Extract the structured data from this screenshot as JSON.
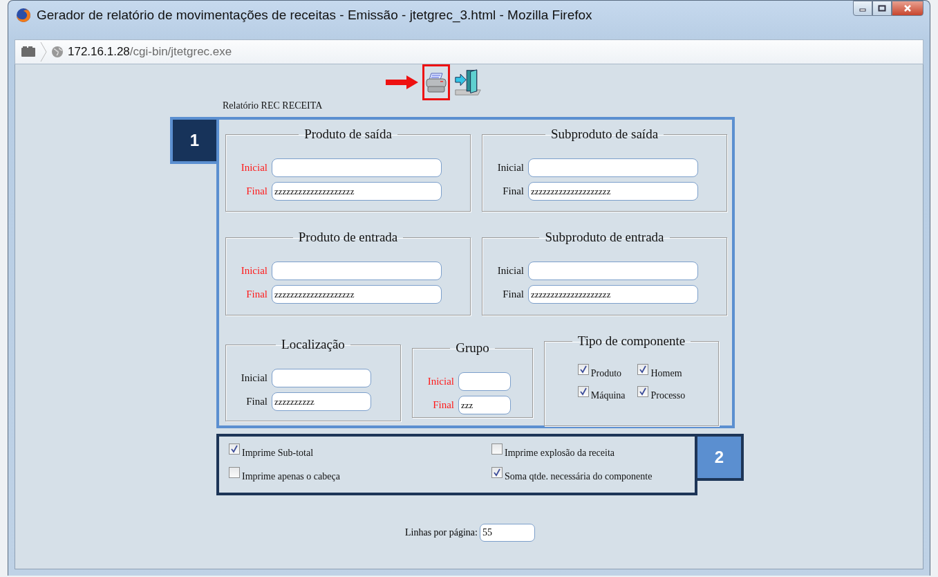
{
  "window": {
    "title": "Gerador de relatório de movimentações de receitas - Emissão - jtetgrec_3.html - Mozilla Firefox"
  },
  "address_bar": {
    "host": "172.16.1.28",
    "path": "/cgi-bin/jtetgrec.exe"
  },
  "toolbar": [
    {
      "kind": "print",
      "highlighted": true
    },
    {
      "kind": "exit",
      "highlighted": false
    }
  ],
  "report_title": "Relatório REC RECEITA",
  "section_1": {
    "badge": "1",
    "fieldsets": [
      {
        "kind": "range",
        "legend": "Produto de saída",
        "fields": [
          {
            "label": "Inicial",
            "required": true
          },
          {
            "label": "Final",
            "value": "zzzzzzzzzzzzzzzzzzzz",
            "required": true
          }
        ]
      },
      {
        "kind": "range",
        "legend": "Subproduto de saída",
        "fields": [
          {
            "label": "Inicial",
            "required": false
          },
          {
            "label": "Final",
            "value": "zzzzzzzzzzzzzzzzzzzz",
            "required": false
          }
        ]
      },
      {
        "kind": "range",
        "legend": "Produto de entrada",
        "fields": [
          {
            "label": "Inicial",
            "required": true
          },
          {
            "label": "Final",
            "value": "zzzzzzzzzzzzzzzzzzzz",
            "required": true
          }
        ]
      },
      {
        "kind": "range",
        "legend": "Subproduto de entrada",
        "fields": [
          {
            "label": "Inicial",
            "required": false
          },
          {
            "label": "Final",
            "value": "zzzzzzzzzzzzzzzzzzzz",
            "required": false
          }
        ]
      },
      {
        "kind": "range",
        "legend": "Localização",
        "fields": [
          {
            "label": "Inicial",
            "required": false
          },
          {
            "label": "Final",
            "value": "zzzzzzzzzz",
            "required": false
          }
        ]
      },
      {
        "kind": "range",
        "legend": "Grupo",
        "fields": [
          {
            "label": "Inicial",
            "required": true
          },
          {
            "label": "Final",
            "value": "zzz",
            "required": true
          }
        ]
      },
      {
        "kind": "checkboxes",
        "legend": "Tipo de componente",
        "options": [
          {
            "label": "Produto",
            "checked": true
          },
          {
            "label": "Homem",
            "checked": true
          },
          {
            "label": "Máquina",
            "checked": true
          },
          {
            "label": "Processo",
            "checked": true
          }
        ]
      }
    ]
  },
  "section_2": {
    "badge": "2",
    "options": [
      {
        "label": "Imprime Sub-total",
        "checked": true
      },
      {
        "label": "Imprime explosão da receita",
        "checked": false
      },
      {
        "label": "Imprime apenas o cabeça",
        "checked": false
      },
      {
        "label": "Soma qtde. necessária do componente",
        "checked": true
      }
    ]
  },
  "lines_per_page": {
    "label": "Linhas por página:",
    "value": "55"
  }
}
